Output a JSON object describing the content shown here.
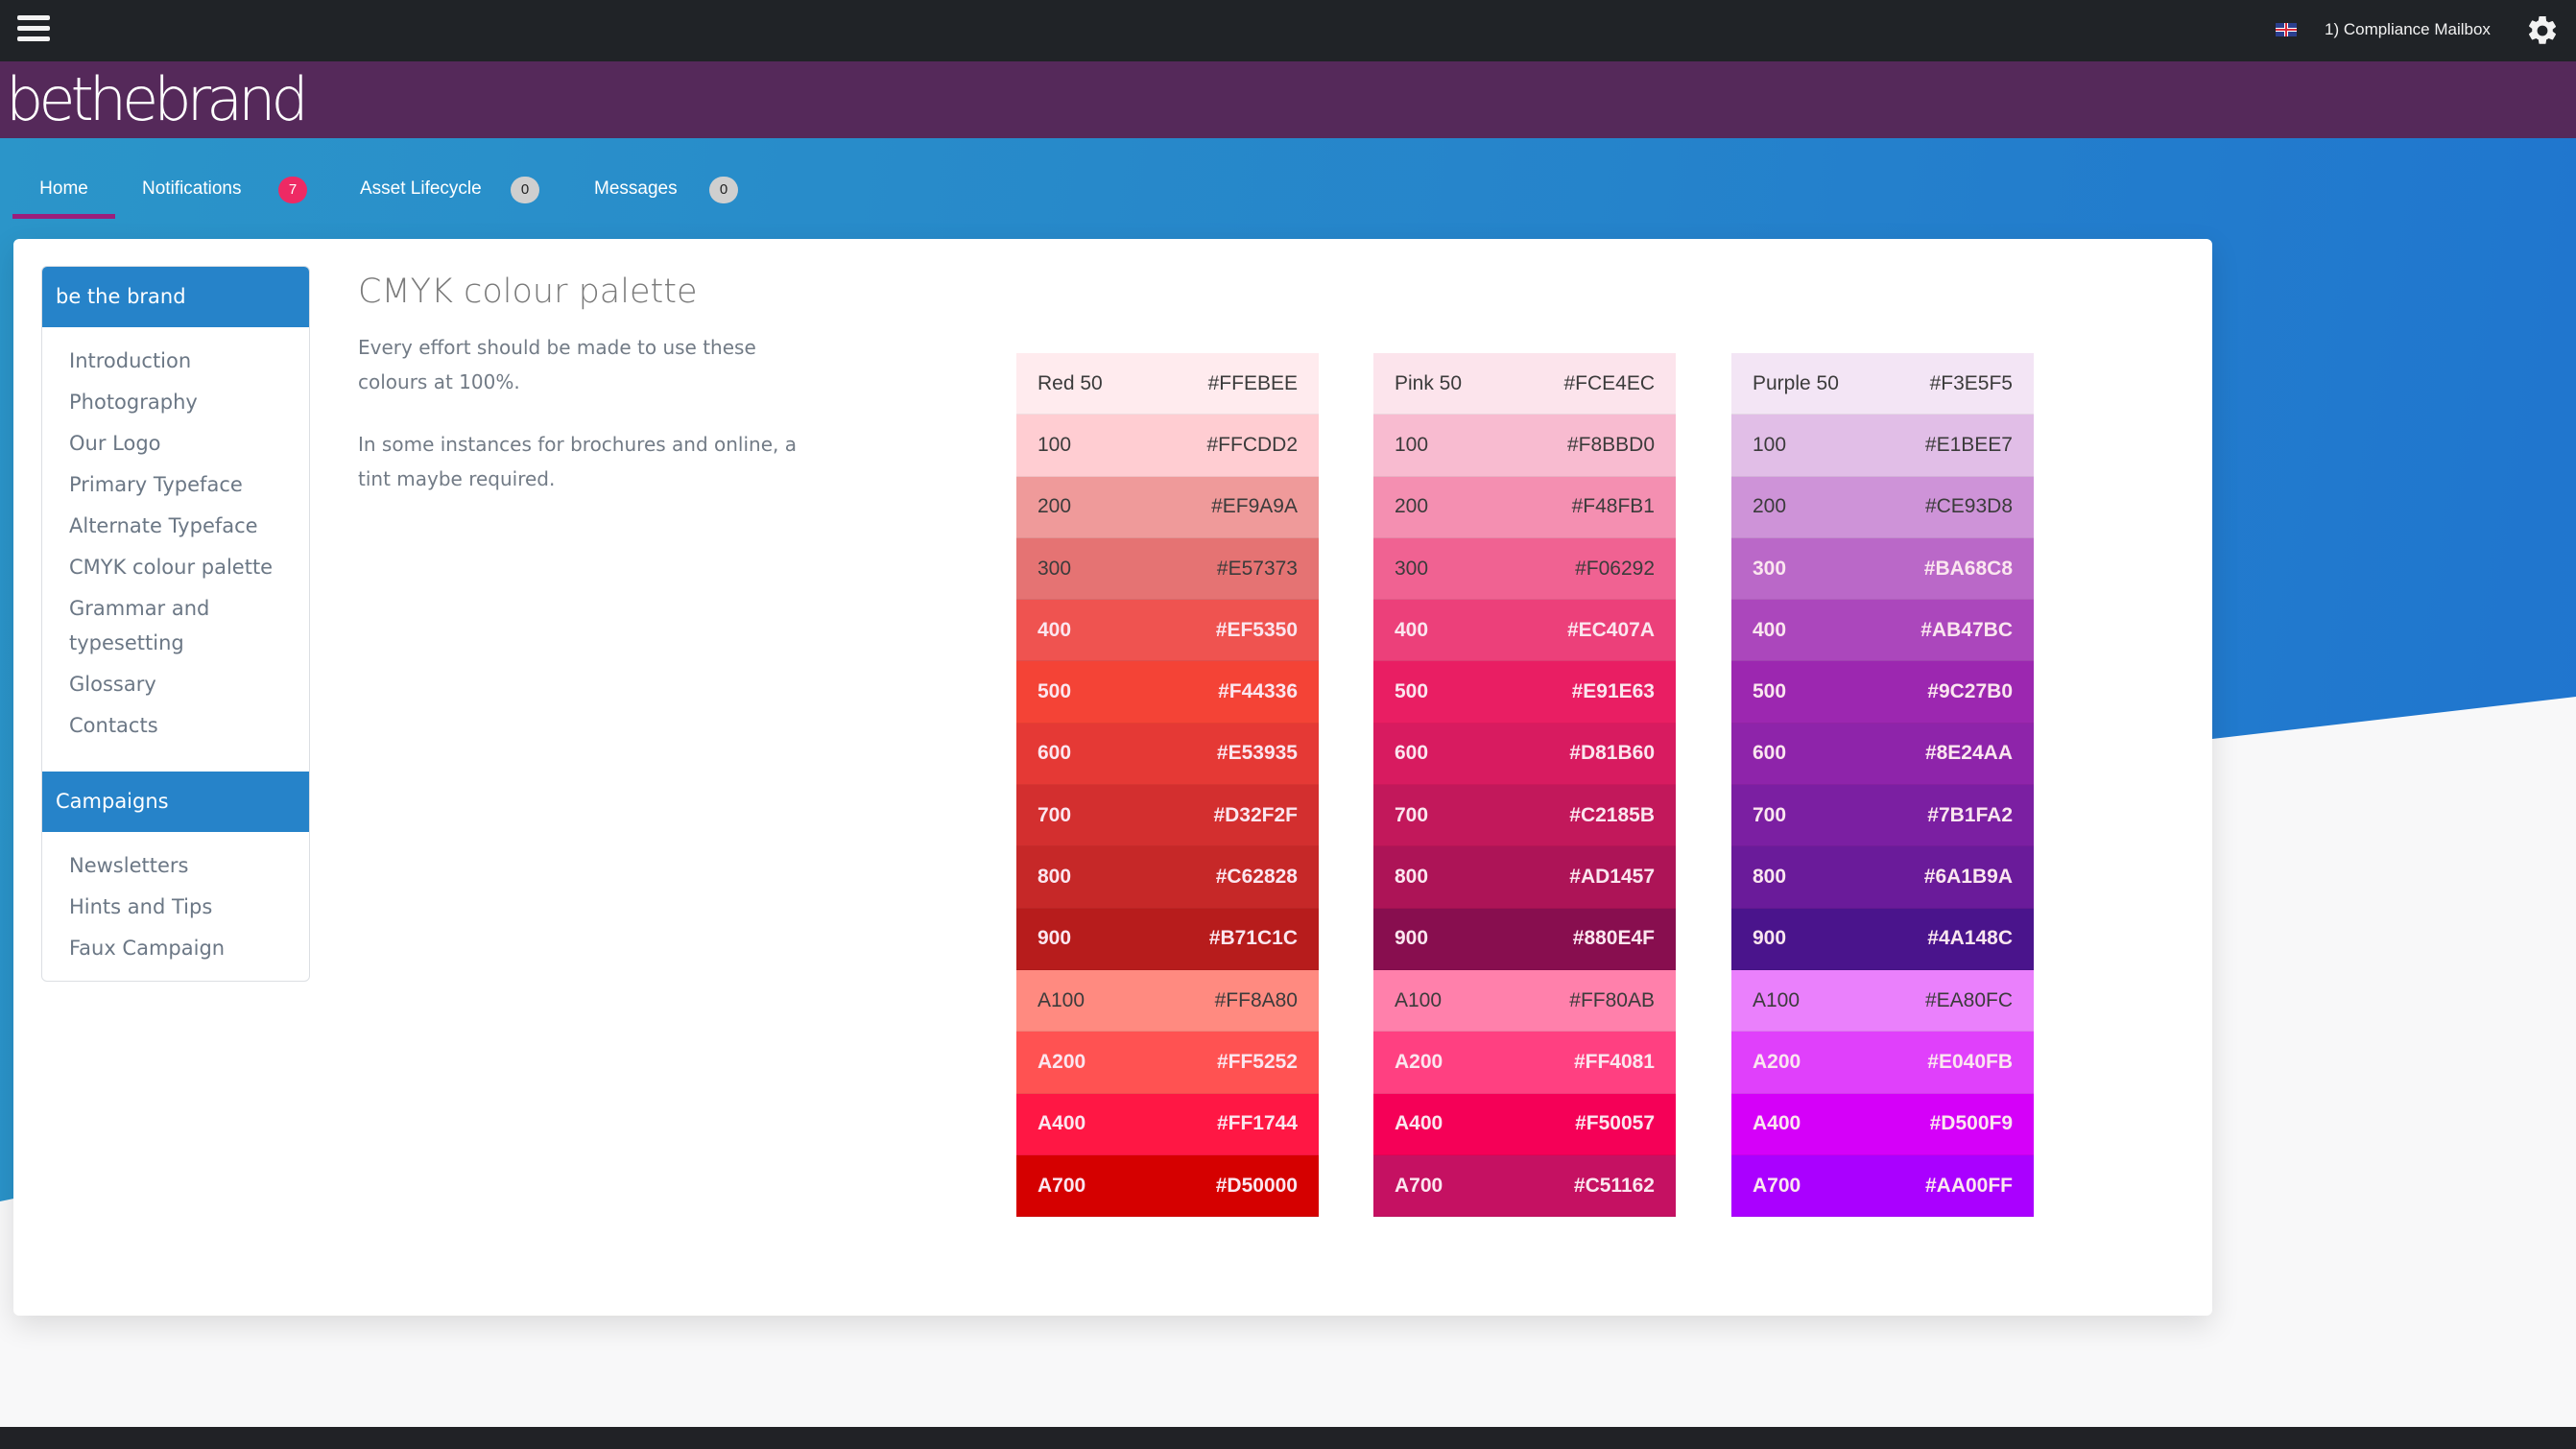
{
  "topbar": {
    "menu_icon": "hamburger-menu-icon",
    "flag_icon": "uk-flag-icon",
    "mailbox_label": "1) Compliance Mailbox",
    "settings_icon": "gear-icon"
  },
  "brand": {
    "logo_text": "bethebrand"
  },
  "tabs": [
    {
      "label": "Home",
      "active": true
    },
    {
      "label": "Notifications",
      "badge": "7"
    },
    {
      "label": "Asset Lifecycle",
      "badge": "0"
    },
    {
      "label": "Messages",
      "badge": "0"
    }
  ],
  "sidebar": {
    "sections": [
      {
        "title": "be the brand",
        "items": [
          "Introduction",
          "Photography",
          "Our Logo",
          "Primary Typeface",
          "Alternate Typeface",
          "CMYK colour palette",
          "Grammar and typesetting",
          "Glossary",
          "Contacts"
        ]
      },
      {
        "title": "Campaigns",
        "items": [
          "Newsletters",
          "Hints and Tips",
          "Faux Campaign"
        ]
      }
    ]
  },
  "content": {
    "title": "CMYK colour palette",
    "paragraphs": [
      "Every effort should be made to use these colours at 100%.",
      "In some instances for brochures and online, a tint maybe required."
    ]
  },
  "palettes": [
    {
      "name": "Red",
      "swatches": [
        {
          "label": "Red 50",
          "hex": "#FFEBEE",
          "text": "dark"
        },
        {
          "label": "100",
          "hex": "#FFCDD2",
          "text": "dark"
        },
        {
          "label": "200",
          "hex": "#EF9A9A",
          "text": "dark"
        },
        {
          "label": "300",
          "hex": "#E57373",
          "text": "dark"
        },
        {
          "label": "400",
          "hex": "#EF5350",
          "text": "light"
        },
        {
          "label": "500",
          "hex": "#F44336",
          "text": "light"
        },
        {
          "label": "600",
          "hex": "#E53935",
          "text": "light"
        },
        {
          "label": "700",
          "hex": "#D32F2F",
          "text": "light"
        },
        {
          "label": "800",
          "hex": "#C62828",
          "text": "light"
        },
        {
          "label": "900",
          "hex": "#B71C1C",
          "text": "light"
        },
        {
          "label": "A100",
          "hex": "#FF8A80",
          "text": "dark"
        },
        {
          "label": "A200",
          "hex": "#FF5252",
          "text": "light"
        },
        {
          "label": "A400",
          "hex": "#FF1744",
          "text": "light"
        },
        {
          "label": "A700",
          "hex": "#D50000",
          "text": "light"
        }
      ]
    },
    {
      "name": "Pink",
      "swatches": [
        {
          "label": "Pink 50",
          "hex": "#FCE4EC",
          "text": "dark"
        },
        {
          "label": "100",
          "hex": "#F8BBD0",
          "text": "dark"
        },
        {
          "label": "200",
          "hex": "#F48FB1",
          "text": "dark"
        },
        {
          "label": "300",
          "hex": "#F06292",
          "text": "dark"
        },
        {
          "label": "400",
          "hex": "#EC407A",
          "text": "light"
        },
        {
          "label": "500",
          "hex": "#E91E63",
          "text": "light"
        },
        {
          "label": "600",
          "hex": "#D81B60",
          "text": "light"
        },
        {
          "label": "700",
          "hex": "#C2185B",
          "text": "light"
        },
        {
          "label": "800",
          "hex": "#AD1457",
          "text": "light"
        },
        {
          "label": "900",
          "hex": "#880E4F",
          "text": "light"
        },
        {
          "label": "A100",
          "hex": "#FF80AB",
          "text": "dark"
        },
        {
          "label": "A200",
          "hex": "#FF4081",
          "text": "light"
        },
        {
          "label": "A400",
          "hex": "#F50057",
          "text": "light"
        },
        {
          "label": "A700",
          "hex": "#C51162",
          "text": "light"
        }
      ]
    },
    {
      "name": "Purple",
      "swatches": [
        {
          "label": "Purple 50",
          "hex": "#F3E5F5",
          "text": "dark"
        },
        {
          "label": "100",
          "hex": "#E1BEE7",
          "text": "dark"
        },
        {
          "label": "200",
          "hex": "#CE93D8",
          "text": "dark"
        },
        {
          "label": "300",
          "hex": "#BA68C8",
          "text": "light"
        },
        {
          "label": "400",
          "hex": "#AB47BC",
          "text": "light"
        },
        {
          "label": "500",
          "hex": "#9C27B0",
          "text": "light"
        },
        {
          "label": "600",
          "hex": "#8E24AA",
          "text": "light"
        },
        {
          "label": "700",
          "hex": "#7B1FA2",
          "text": "light"
        },
        {
          "label": "800",
          "hex": "#6A1B9A",
          "text": "light"
        },
        {
          "label": "900",
          "hex": "#4A148C",
          "text": "light"
        },
        {
          "label": "A100",
          "hex": "#EA80FC",
          "text": "dark"
        },
        {
          "label": "A200",
          "hex": "#E040FB",
          "text": "light"
        },
        {
          "label": "A400",
          "hex": "#D500F9",
          "text": "light"
        },
        {
          "label": "A700",
          "hex": "#AA00FF",
          "text": "light"
        }
      ]
    }
  ],
  "colors": {
    "topbar": "#202327",
    "brandbar": "#55295a",
    "hero_blue": "#2b93c9",
    "sidebar_header": "#2683c9",
    "tab_underline": "#9a1e7c",
    "notification_badge": "#ee2a64"
  }
}
